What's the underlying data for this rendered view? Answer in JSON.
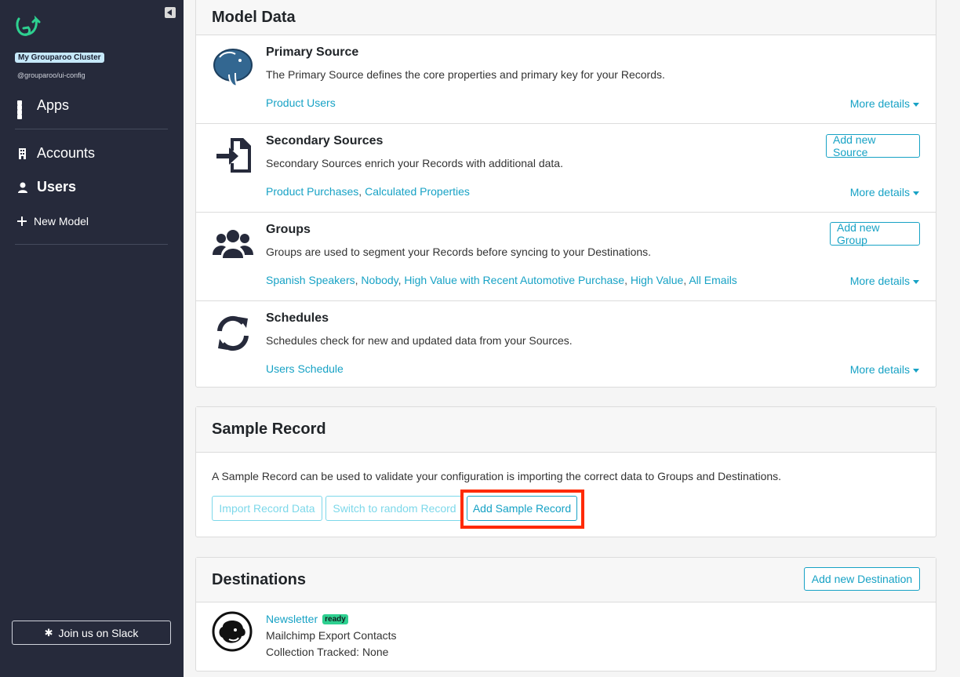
{
  "sidebar": {
    "cluster_name": "My Grouparoo Cluster",
    "cluster_subtitle": "@grouparoo/ui-config",
    "nav": {
      "apps": "Apps",
      "accounts": "Accounts",
      "users": "Users",
      "new_model": "New Model"
    },
    "slack_label": "Join us on Slack"
  },
  "model_data": {
    "title": "Model Data",
    "rows": [
      {
        "title": "Primary Source",
        "description": "The Primary Source defines the core properties and primary key for your Records.",
        "links": [
          "Product Users"
        ],
        "more": "More details",
        "icon": "postgres-elephant-icon"
      },
      {
        "title": "Secondary Sources",
        "description": "Secondary Sources enrich your Records with additional data.",
        "links": [
          "Product Purchases",
          "Calculated Properties"
        ],
        "more": "More details",
        "button": "Add new Source",
        "icon": "file-import-icon"
      },
      {
        "title": "Groups",
        "description": "Groups are used to segment your Records before syncing to your Destinations.",
        "links": [
          "Spanish Speakers",
          "Nobody",
          "High Value with Recent Automotive Purchase",
          "High Value",
          "All Emails"
        ],
        "more": "More details",
        "button": "Add new Group",
        "icon": "users-icon"
      },
      {
        "title": "Schedules",
        "description": "Schedules check for new and updated data from your Sources.",
        "links": [
          "Users Schedule"
        ],
        "more": "More details",
        "icon": "sync-icon"
      }
    ]
  },
  "sample_record": {
    "title": "Sample Record",
    "description": "A Sample Record can be used to validate your configuration is importing the correct data to Groups and Destinations.",
    "import_label": "Import Record Data",
    "switch_label": "Switch to random Record",
    "add_label": "Add Sample Record"
  },
  "destinations": {
    "title": "Destinations",
    "add_label": "Add new Destination",
    "items": [
      {
        "name": "Newsletter",
        "status": "ready",
        "type": "Mailchimp Export Contacts",
        "collection": "Collection Tracked: None"
      }
    ]
  },
  "colors": {
    "sidebar_bg": "#262a3b",
    "accent": "#17a2c5",
    "highlight": "#ff2a00",
    "ready": "#2ed090"
  }
}
